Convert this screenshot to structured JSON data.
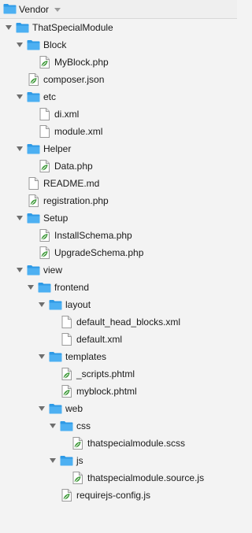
{
  "header": {
    "title": "Vendor",
    "icon": "folder-icon",
    "dropdown_icon": "chevron-down-icon"
  },
  "colors": {
    "folder": "#2e9ae6",
    "folder_tab": "#4db0f2",
    "background": "#f3f3f3",
    "php_file": "#3f9a3a"
  },
  "tree": [
    {
      "label": "ThatSpecialModule",
      "depth": 0,
      "kind": "folder",
      "expanded": true
    },
    {
      "label": "Block",
      "depth": 1,
      "kind": "folder",
      "expanded": true
    },
    {
      "label": "MyBlock.php",
      "depth": 2,
      "kind": "code-file"
    },
    {
      "label": "composer.json",
      "depth": 1,
      "kind": "code-file"
    },
    {
      "label": "etc",
      "depth": 1,
      "kind": "folder",
      "expanded": true
    },
    {
      "label": "di.xml",
      "depth": 2,
      "kind": "plain-file"
    },
    {
      "label": "module.xml",
      "depth": 2,
      "kind": "plain-file"
    },
    {
      "label": "Helper",
      "depth": 1,
      "kind": "folder",
      "expanded": true
    },
    {
      "label": "Data.php",
      "depth": 2,
      "kind": "code-file"
    },
    {
      "label": "README.md",
      "depth": 1,
      "kind": "plain-file"
    },
    {
      "label": "registration.php",
      "depth": 1,
      "kind": "code-file"
    },
    {
      "label": "Setup",
      "depth": 1,
      "kind": "folder",
      "expanded": true
    },
    {
      "label": "InstallSchema.php",
      "depth": 2,
      "kind": "code-file"
    },
    {
      "label": "UpgradeSchema.php",
      "depth": 2,
      "kind": "code-file"
    },
    {
      "label": "view",
      "depth": 1,
      "kind": "folder",
      "expanded": true
    },
    {
      "label": "frontend",
      "depth": 2,
      "kind": "folder",
      "expanded": true
    },
    {
      "label": "layout",
      "depth": 3,
      "kind": "folder",
      "expanded": true
    },
    {
      "label": "default_head_blocks.xml",
      "depth": 4,
      "kind": "plain-file"
    },
    {
      "label": "default.xml",
      "depth": 4,
      "kind": "plain-file"
    },
    {
      "label": "templates",
      "depth": 3,
      "kind": "folder",
      "expanded": true
    },
    {
      "label": "_scripts.phtml",
      "depth": 4,
      "kind": "code-file"
    },
    {
      "label": "myblock.phtml",
      "depth": 4,
      "kind": "code-file"
    },
    {
      "label": "web",
      "depth": 3,
      "kind": "folder",
      "expanded": true
    },
    {
      "label": "css",
      "depth": 4,
      "kind": "folder",
      "expanded": true
    },
    {
      "label": "thatspecialmodule.scss",
      "depth": 5,
      "kind": "code-file"
    },
    {
      "label": "js",
      "depth": 4,
      "kind": "folder",
      "expanded": true
    },
    {
      "label": "thatspecialmodule.source.js",
      "depth": 5,
      "kind": "code-file"
    },
    {
      "label": "requirejs-config.js",
      "depth": 4,
      "kind": "code-file"
    }
  ]
}
